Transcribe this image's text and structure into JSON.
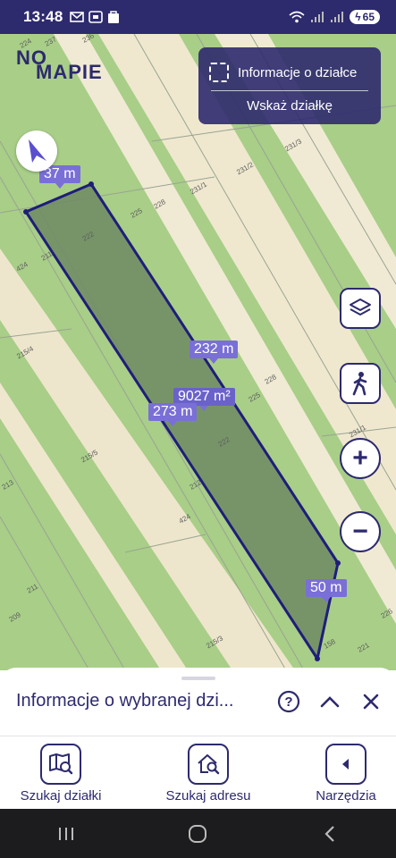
{
  "status_bar": {
    "time": "13:48",
    "battery": "65",
    "icons": [
      "gmail-icon",
      "screenshot-icon",
      "bag-icon",
      "wifi-icon",
      "signal-icon",
      "signal-icon",
      "battery-icon"
    ]
  },
  "logo": {
    "line1": "NO",
    "line2": "MAPIE"
  },
  "info_panel": {
    "title": "Informacje o działce",
    "action": "Wskaż działkę"
  },
  "map": {
    "measure_labels": [
      "37 m",
      "232 m",
      "9027 m²",
      "273 m",
      "50 m"
    ],
    "parcel_numbers": [
      "224",
      "237",
      "225",
      "228",
      "231/1",
      "231/2",
      "231/3",
      "222",
      "424",
      "215/4",
      "215/5",
      "213",
      "211",
      "209",
      "215/3",
      "226",
      "221",
      "158",
      "231/1",
      "222",
      "212",
      "211",
      "225",
      "228",
      "424",
      "236"
    ],
    "colors": {
      "parcel_fill": "#6e8a64",
      "parcel_stroke": "#1f1d7a",
      "label_bg": "#7a6fd6",
      "brand": "#2d2a6e"
    }
  },
  "map_buttons": {
    "layers": "layers-icon",
    "walk": "walk-icon",
    "zoom_in": "+",
    "zoom_out": "−"
  },
  "sheet": {
    "title": "Informacje o wybranej dzi...",
    "help": "?",
    "collapse": "^",
    "close": "×"
  },
  "tabs": [
    {
      "label": "Szukaj działki",
      "icon": "map-search-icon"
    },
    {
      "label": "Szukaj adresu",
      "icon": "home-search-icon"
    },
    {
      "label": "Narzędzia",
      "icon": "arrow-left-icon"
    }
  ]
}
